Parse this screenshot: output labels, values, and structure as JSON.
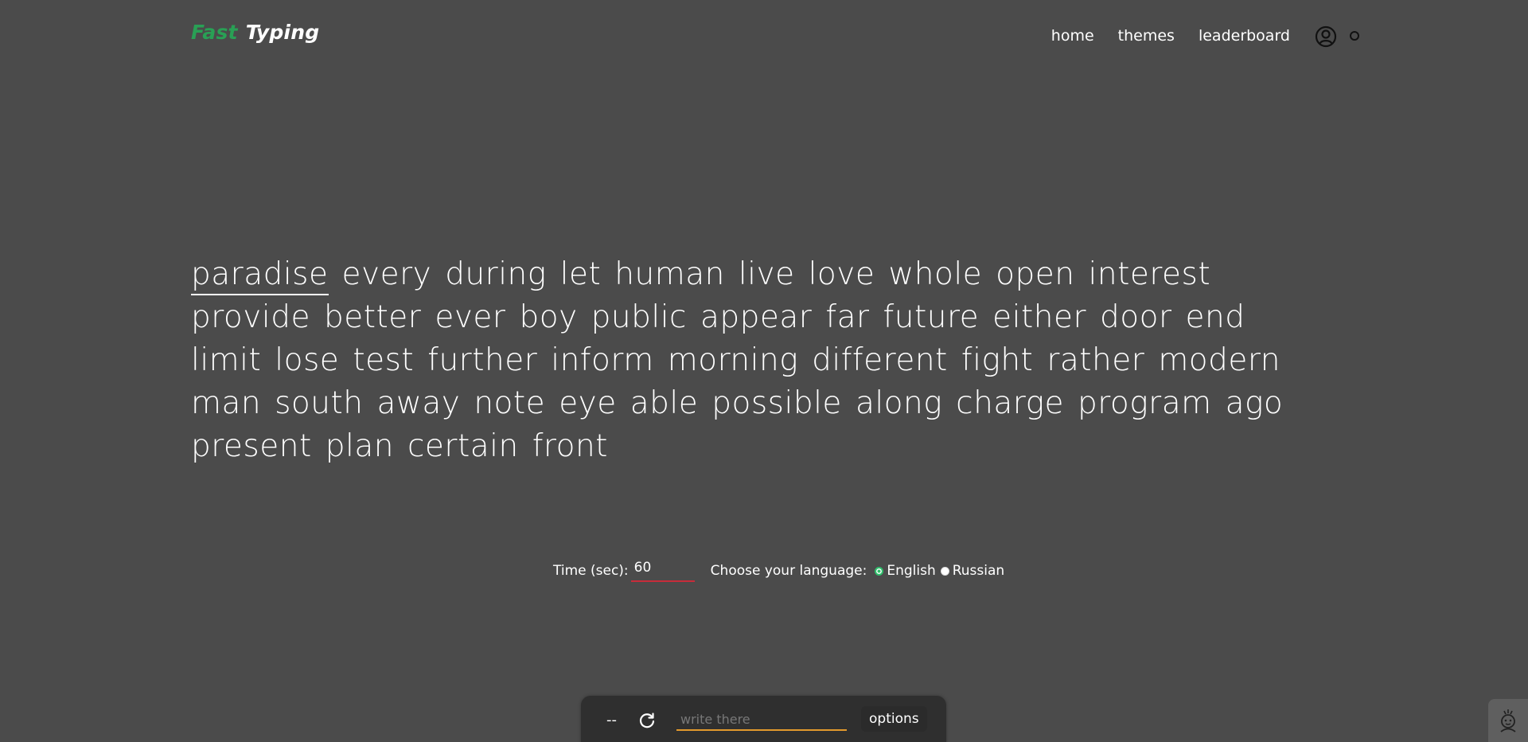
{
  "header": {
    "logo_fast": "Fast",
    "logo_typing": "Typing",
    "nav": {
      "home": "home",
      "themes": "themes",
      "leaderboard": "leaderboard"
    }
  },
  "words": [
    "paradise",
    "every",
    "during",
    "let",
    "human",
    "live",
    "love",
    "whole",
    "open",
    "interest",
    "provide",
    "better",
    "ever",
    "boy",
    "public",
    "appear",
    "far",
    "future",
    "either",
    "door",
    "end",
    "limit",
    "lose",
    "test",
    "further",
    "inform",
    "morning",
    "different",
    "fight",
    "rather",
    "modern",
    "man",
    "south",
    "away",
    "note",
    "eye",
    "able",
    "possible",
    "along",
    "charge",
    "program",
    "ago",
    "present",
    "plan",
    "certain",
    "front"
  ],
  "current_word_index": 0,
  "settings": {
    "time_label": "Time (sec):",
    "time_value": "60",
    "language_label": "Choose your language:",
    "languages": [
      "English",
      "Russian"
    ],
    "selected_language": "English"
  },
  "bottom_bar": {
    "counter": "--",
    "input_placeholder": "write there",
    "options_label": "options"
  },
  "colors": {
    "background": "#4b4b4b",
    "accent_green": "#29a055",
    "time_underline": "#c72c3a",
    "input_underline": "#e39a2d",
    "bar_background": "#2f2f2f"
  }
}
